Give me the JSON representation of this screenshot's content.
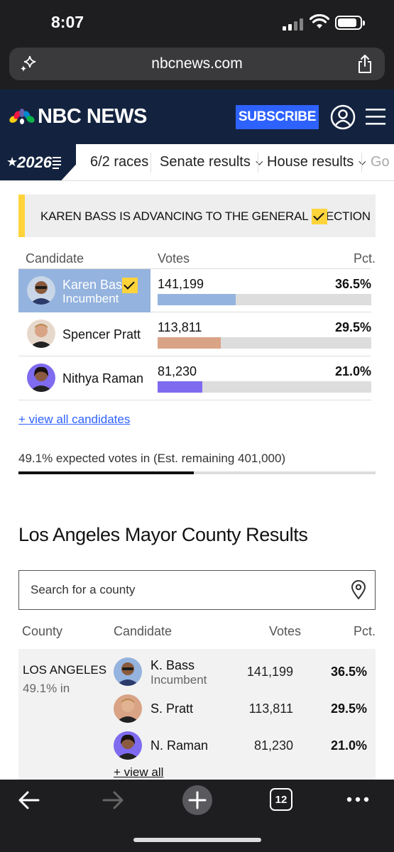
{
  "status_bar": {
    "time": "8:07"
  },
  "browser": {
    "url": "nbcnews.com",
    "tab_count": "12"
  },
  "header": {
    "brand": "NBC NEWS",
    "subscribe_label": "SUBSCRIBE"
  },
  "nav": {
    "logo": "2026",
    "items": [
      {
        "label": "6/2 races"
      },
      {
        "label": "Senate results"
      },
      {
        "label": "House results"
      },
      {
        "label": "Go"
      }
    ]
  },
  "banner": {
    "text": "KAREN BASS IS ADVANCING TO THE GENERAL ELECTION"
  },
  "results": {
    "headers": {
      "candidate": "Candidate",
      "votes": "Votes",
      "pct": "Pct."
    },
    "candidates": [
      {
        "name": "Karen Bass",
        "sub": "Incumbent",
        "votes": "141,199",
        "pct": "36.5%",
        "share": 36.5,
        "color": "#94b3de"
      },
      {
        "name": "Spencer Pratt",
        "votes": "113,811",
        "pct": "29.5%",
        "share": 29.5,
        "color": "#d9a386"
      },
      {
        "name": "Nithya Raman",
        "votes": "81,230",
        "pct": "21.0%",
        "share": 21.0,
        "color": "#7e6bef"
      }
    ],
    "view_all": "+ view all candidates",
    "expected": "49.1% expected votes in (Est. remaining 401,000)",
    "expected_share": 49.1
  },
  "county_section": {
    "title": "Los Angeles Mayor County Results",
    "search_placeholder": "Search for a county",
    "headers": {
      "county": "County",
      "candidate": "Candidate",
      "votes": "Votes",
      "pct": "Pct."
    },
    "county": {
      "name": "LOS ANGELES",
      "reporting": "49.1% in",
      "candidates": [
        {
          "name": "K. Bass",
          "sub": "Incumbent",
          "votes": "141,199",
          "pct": "36.5%"
        },
        {
          "name": "S. Pratt",
          "votes": "113,811",
          "pct": "29.5%"
        },
        {
          "name": "N. Raman",
          "votes": "81,230",
          "pct": "21.0%"
        }
      ],
      "view_all": "+ view all"
    }
  }
}
